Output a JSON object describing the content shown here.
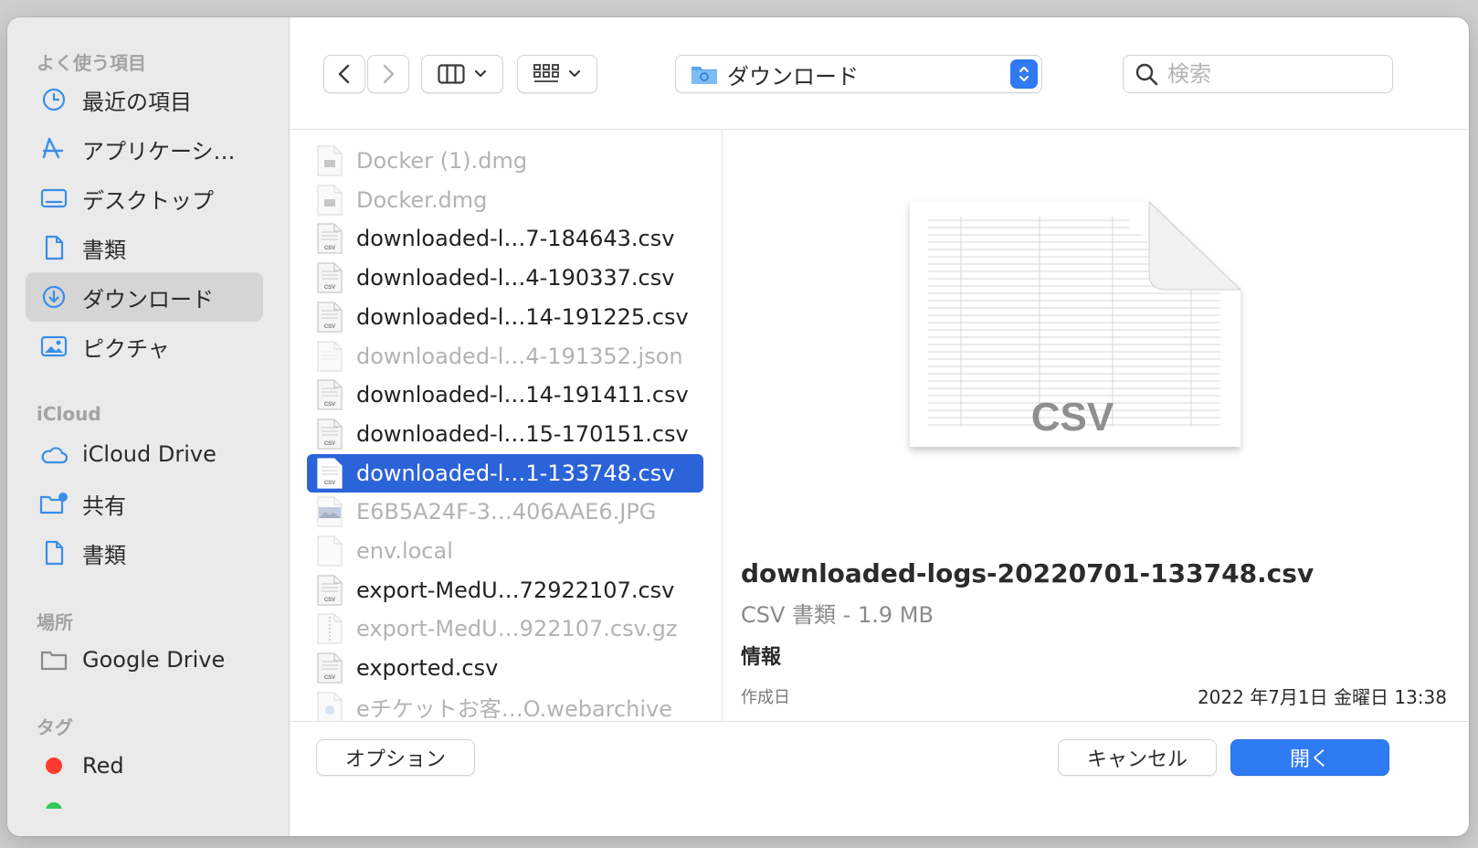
{
  "sidebar": {
    "favorites_header": "よく使う項目",
    "favorites": [
      {
        "label": "最近の項目",
        "icon": "clock-icon"
      },
      {
        "label": "アプリケーシ…",
        "icon": "applications-icon"
      },
      {
        "label": "デスクトップ",
        "icon": "desktop-icon"
      },
      {
        "label": "書類",
        "icon": "document-icon"
      },
      {
        "label": "ダウンロード",
        "icon": "download-icon",
        "selected": true
      },
      {
        "label": "ピクチャ",
        "icon": "photo-icon"
      }
    ],
    "icloud_header": "iCloud",
    "icloud": [
      {
        "label": "iCloud Drive",
        "icon": "cloud-icon"
      },
      {
        "label": "共有",
        "icon": "shared-folder-icon"
      },
      {
        "label": "書類",
        "icon": "document-icon"
      }
    ],
    "locations_header": "場所",
    "locations": [
      {
        "label": "Google Drive",
        "icon": "folder-icon"
      }
    ],
    "tags_header": "タグ",
    "tags": [
      {
        "label": "Red",
        "color": "#ff3b30"
      }
    ]
  },
  "toolbar": {
    "location": "ダウンロード",
    "search_placeholder": "検索"
  },
  "files": [
    {
      "name": "Docker (1).dmg",
      "dim": true,
      "icon": "dmg-file-icon"
    },
    {
      "name": "Docker.dmg",
      "dim": true,
      "icon": "dmg-file-icon"
    },
    {
      "name": "downloaded-l…7-184643.csv",
      "dim": false,
      "icon": "csv-file-icon"
    },
    {
      "name": "downloaded-l…4-190337.csv",
      "dim": false,
      "icon": "csv-file-icon"
    },
    {
      "name": "downloaded-l…14-191225.csv",
      "dim": false,
      "icon": "csv-file-icon"
    },
    {
      "name": "downloaded-l…4-191352.json",
      "dim": true,
      "icon": "json-file-icon"
    },
    {
      "name": "downloaded-l…14-191411.csv",
      "dim": false,
      "icon": "csv-file-icon"
    },
    {
      "name": "downloaded-l…15-170151.csv",
      "dim": false,
      "icon": "csv-file-icon"
    },
    {
      "name": "downloaded-l…1-133748.csv",
      "dim": false,
      "selected": true,
      "icon": "csv-file-icon"
    },
    {
      "name": "E6B5A24F-3…406AAE6.JPG",
      "dim": true,
      "icon": "image-file-icon"
    },
    {
      "name": "env.local",
      "dim": true,
      "icon": "blank-file-icon"
    },
    {
      "name": "export-MedU…72922107.csv",
      "dim": false,
      "icon": "csv-file-icon"
    },
    {
      "name": "export-MedU…922107.csv.gz",
      "dim": true,
      "icon": "zip-file-icon"
    },
    {
      "name": "exported.csv",
      "dim": false,
      "icon": "csv-file-icon"
    },
    {
      "name": "eチケットお客…O.webarchive",
      "dim": true,
      "icon": "webarchive-file-icon"
    }
  ],
  "preview": {
    "doc_label": "CSV",
    "filename": "downloaded-logs-20220701-133748.csv",
    "kind": "CSV 書類 - 1.9 MB",
    "info_header": "情報",
    "created_label": "作成日",
    "created_value": "2022 年7月1日 金曜日 13:38"
  },
  "buttons": {
    "options": "オプション",
    "cancel": "キャンセル",
    "open": "開く"
  }
}
